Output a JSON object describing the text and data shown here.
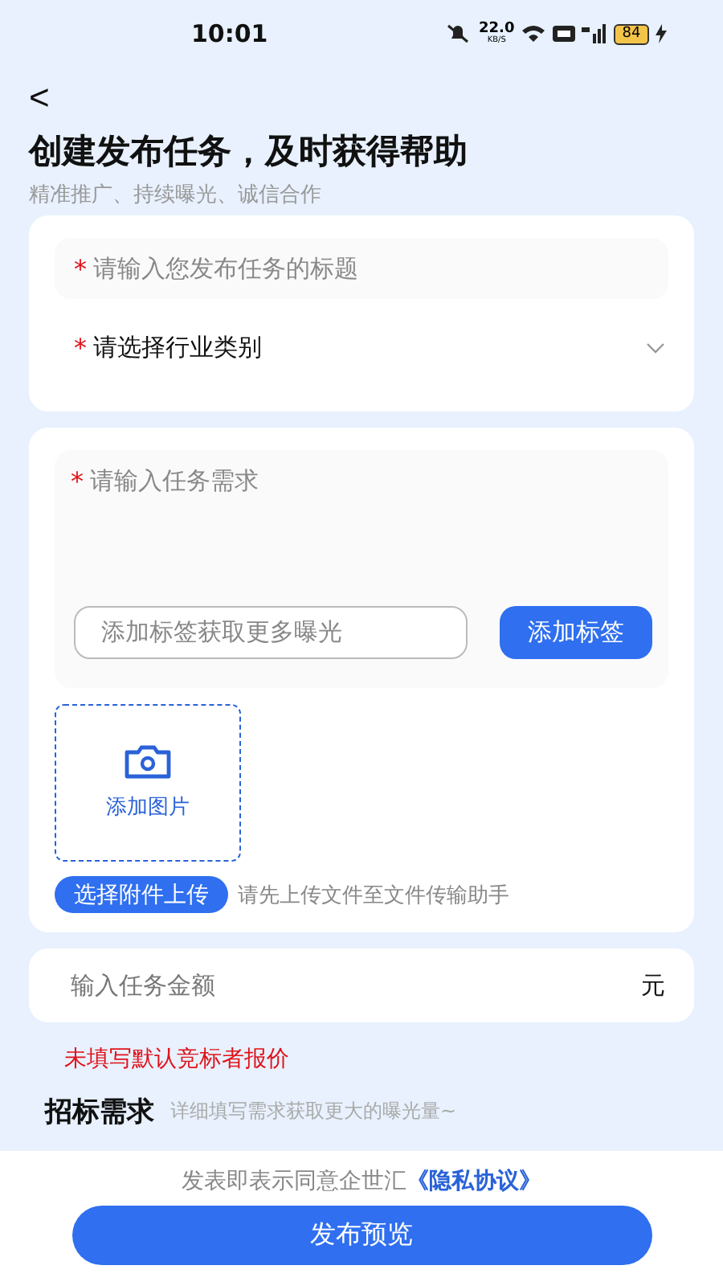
{
  "status_bar": {
    "time": "10:01",
    "net_speed": "22.0",
    "net_unit": "KB/S",
    "battery": "84"
  },
  "header": {
    "back": "<",
    "title": "创建发布任务，及时获得帮助",
    "subtitle": "精准推广、持续曝光、诚信合作"
  },
  "basic_card": {
    "title_field": {
      "required_mark": "*",
      "placeholder": "请输入您发布任务的标题"
    },
    "category": {
      "required_mark": "*",
      "label": "请选择行业类别"
    }
  },
  "detail_card": {
    "requirement": {
      "required_mark": "*",
      "placeholder": "请输入任务需求"
    },
    "tag_field": {
      "placeholder": "添加标签获取更多曝光"
    },
    "tag_button": "添加标签",
    "image_upload": "添加图片",
    "attach_button": "选择附件上传",
    "attach_hint": "请先上传文件至文件传输助手"
  },
  "amount": {
    "placeholder": "输入任务金额",
    "unit": "元"
  },
  "amount_note": "未填写默认竞标者报价",
  "bid_section": {
    "title": "招标需求",
    "hint": "详细填写需求获取更大的曝光量~"
  },
  "footer": {
    "agreement": "发表即表示同意企世汇",
    "agreement_link": "《隐私协议》",
    "submit": "发布预览"
  }
}
